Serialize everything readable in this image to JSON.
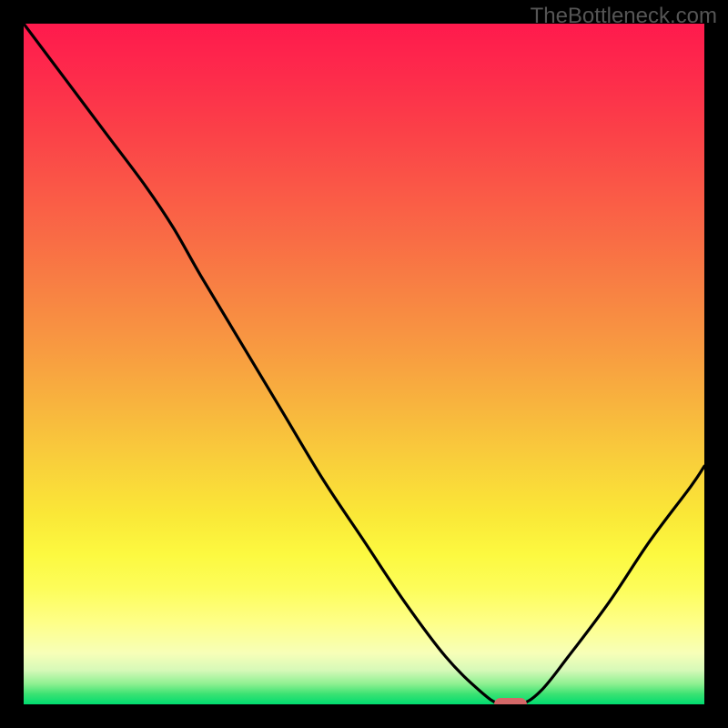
{
  "watermark": {
    "text": "TheBottleneck.com"
  },
  "colors": {
    "page_bg": "#000000",
    "curve_stroke": "#000000",
    "marker_fill": "#d46868",
    "watermark_color": "#555555"
  },
  "chart_data": {
    "type": "line",
    "title": "",
    "xlabel": "",
    "ylabel": "",
    "xlim": [
      0,
      100
    ],
    "ylim": [
      0,
      100
    ],
    "grid": false,
    "legend": false,
    "background": "rainbow-vertical (red top to green bottom)",
    "series": [
      {
        "name": "bottleneck-curve",
        "x": [
          0,
          6,
          12,
          18,
          22,
          26,
          32,
          38,
          44,
          50,
          56,
          62,
          67,
          70,
          73,
          76,
          80,
          86,
          92,
          98,
          100
        ],
        "values": [
          100,
          92,
          84,
          76,
          70,
          63,
          53,
          43,
          33,
          24,
          15,
          7,
          2,
          0,
          0,
          2,
          7,
          15,
          24,
          32,
          35
        ]
      }
    ],
    "marker": {
      "x": 71.5,
      "y": 0,
      "shape": "pill",
      "color": "#d46868"
    }
  }
}
